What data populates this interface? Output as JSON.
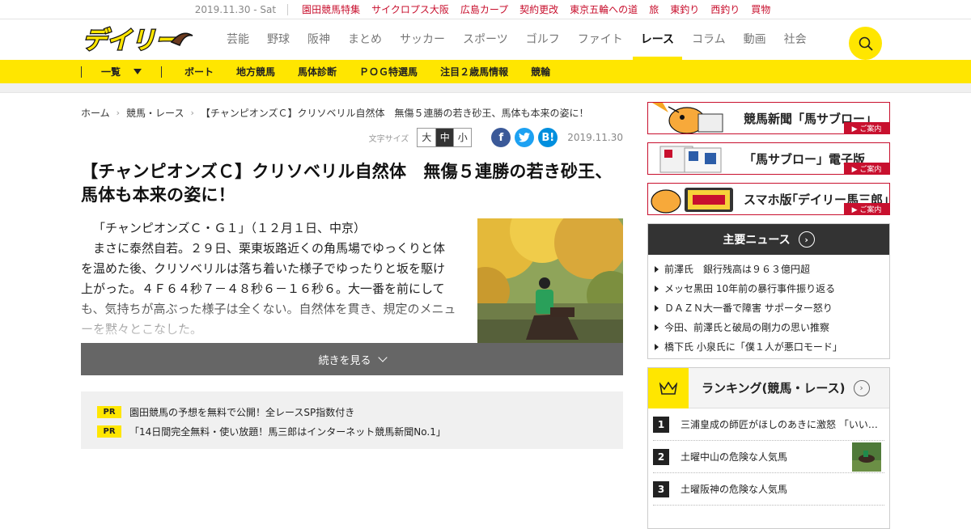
{
  "topbar": {
    "date": "2019.11.30 - Sat",
    "links": [
      "園田競馬特集",
      "サイクロプス大阪",
      "広島カープ",
      "契約更改",
      "東京五輪への道",
      "旅",
      "東釣り",
      "西釣り",
      "買物"
    ]
  },
  "header": {
    "logo_text": "デイリー",
    "nav": [
      "芸能",
      "野球",
      "阪神",
      "まとめ",
      "サッカー",
      "スポーツ",
      "ゴルフ",
      "ファイト",
      "レース",
      "コラム",
      "動画",
      "社会"
    ],
    "active_nav": "レース"
  },
  "subnav": {
    "list_label": "一覧",
    "items": [
      "ボート",
      "地方競馬",
      "馬体診断",
      "ＰＯＧ特選馬",
      "注目２歳馬情報",
      "競輪"
    ]
  },
  "breadcrumb": {
    "home": "ホーム",
    "category": "競馬・レース",
    "current": "【チャンピオンズＣ】クリソベリル自然体　無傷５連勝の若き砂王、馬体も本来の姿に！"
  },
  "meta": {
    "font_size_label": "文字サイズ",
    "font_sizes": [
      "大",
      "中",
      "小"
    ],
    "selected_font_size": "中",
    "social": {
      "facebook": "f",
      "twitter": "t",
      "hatena": "B!"
    },
    "date": "2019.11.30"
  },
  "article": {
    "title": "【チャンピオンズＣ】クリソベリル自然体　無傷５連勝の若き砂王、馬体も本来の姿に！",
    "paragraph1": "「チャンピオンズＣ・Ｇ１」（１２月１日、中京）",
    "paragraph2": "まさに泰然自若。２９日、栗東坂路近くの角馬場でゆっくりと体を温めた後、クリソベリルは落ち着いた様子でゆったりと坂を駆け上がった。４Ｆ６４秒７－４８秒６－１６秒６。大一番を前にしても、気持ちが高ぶった様子は全くない。自然体を貫き、規定のメニューを黙々とこなした。",
    "read_more": "続きを見る"
  },
  "pr": [
    {
      "tag": "PR",
      "text": "園田競馬の予想を無料で公開！全レースSP指数付き"
    },
    {
      "tag": "PR",
      "text": "「14日間完全無料・使い放題！馬三郎はインターネット競馬新聞No.1」"
    }
  ],
  "sidebar": {
    "banners": [
      {
        "title": "競馬新聞「馬サブロー」",
        "button": "▶ ご案内"
      },
      {
        "title": "「馬サブロー」電子版",
        "button": "▶ ご案内"
      },
      {
        "title": "スマホ版｢デイリー馬三郎｣",
        "button": "▶ ご案内"
      }
    ],
    "news_header": "主要ニュース",
    "news": [
      "前澤氏　銀行残高は９６３億円超",
      "メッセ黒田 10年前の暴行事件振り返る",
      "ＤＡＺＮ大一番で障害 サポーター怒り",
      "今田、前澤氏と破局の剛力の思い推察",
      "橋下氏 小泉氏に「僕１人が悪口モード」"
    ],
    "ranking_header": "ランキング(競馬・レース)",
    "ranking": [
      {
        "rank": "1",
        "text": "三浦皇成の師匠がほしのあきに激怒 「いい…"
      },
      {
        "rank": "2",
        "text": "土曜中山の危険な人気馬"
      },
      {
        "rank": "3",
        "text": "土曜阪神の危険な人気馬"
      }
    ]
  },
  "colors": {
    "accent_yellow": "#ffe600",
    "brand_red": "#c8102e",
    "dark": "#333333"
  }
}
